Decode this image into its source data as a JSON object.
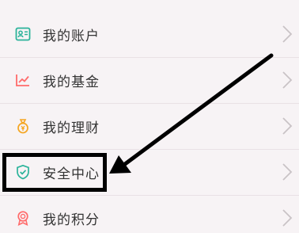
{
  "menu": {
    "items": [
      {
        "label": "我的账户",
        "icon": "account-card-icon",
        "icon_color": "#2bb39a"
      },
      {
        "label": "我的基金",
        "icon": "fund-chart-icon",
        "icon_color": "#ff6b6b"
      },
      {
        "label": "我的理财",
        "icon": "money-bag-icon",
        "icon_color": "#f5a623"
      },
      {
        "label": "安全中心",
        "icon": "shield-check-icon",
        "icon_color": "#2bb39a"
      },
      {
        "label": "我的积分",
        "icon": "award-medal-icon",
        "icon_color": "#ff6b6b"
      }
    ]
  },
  "annotation": {
    "highlight_color": "#000000",
    "target": "安全中心"
  }
}
